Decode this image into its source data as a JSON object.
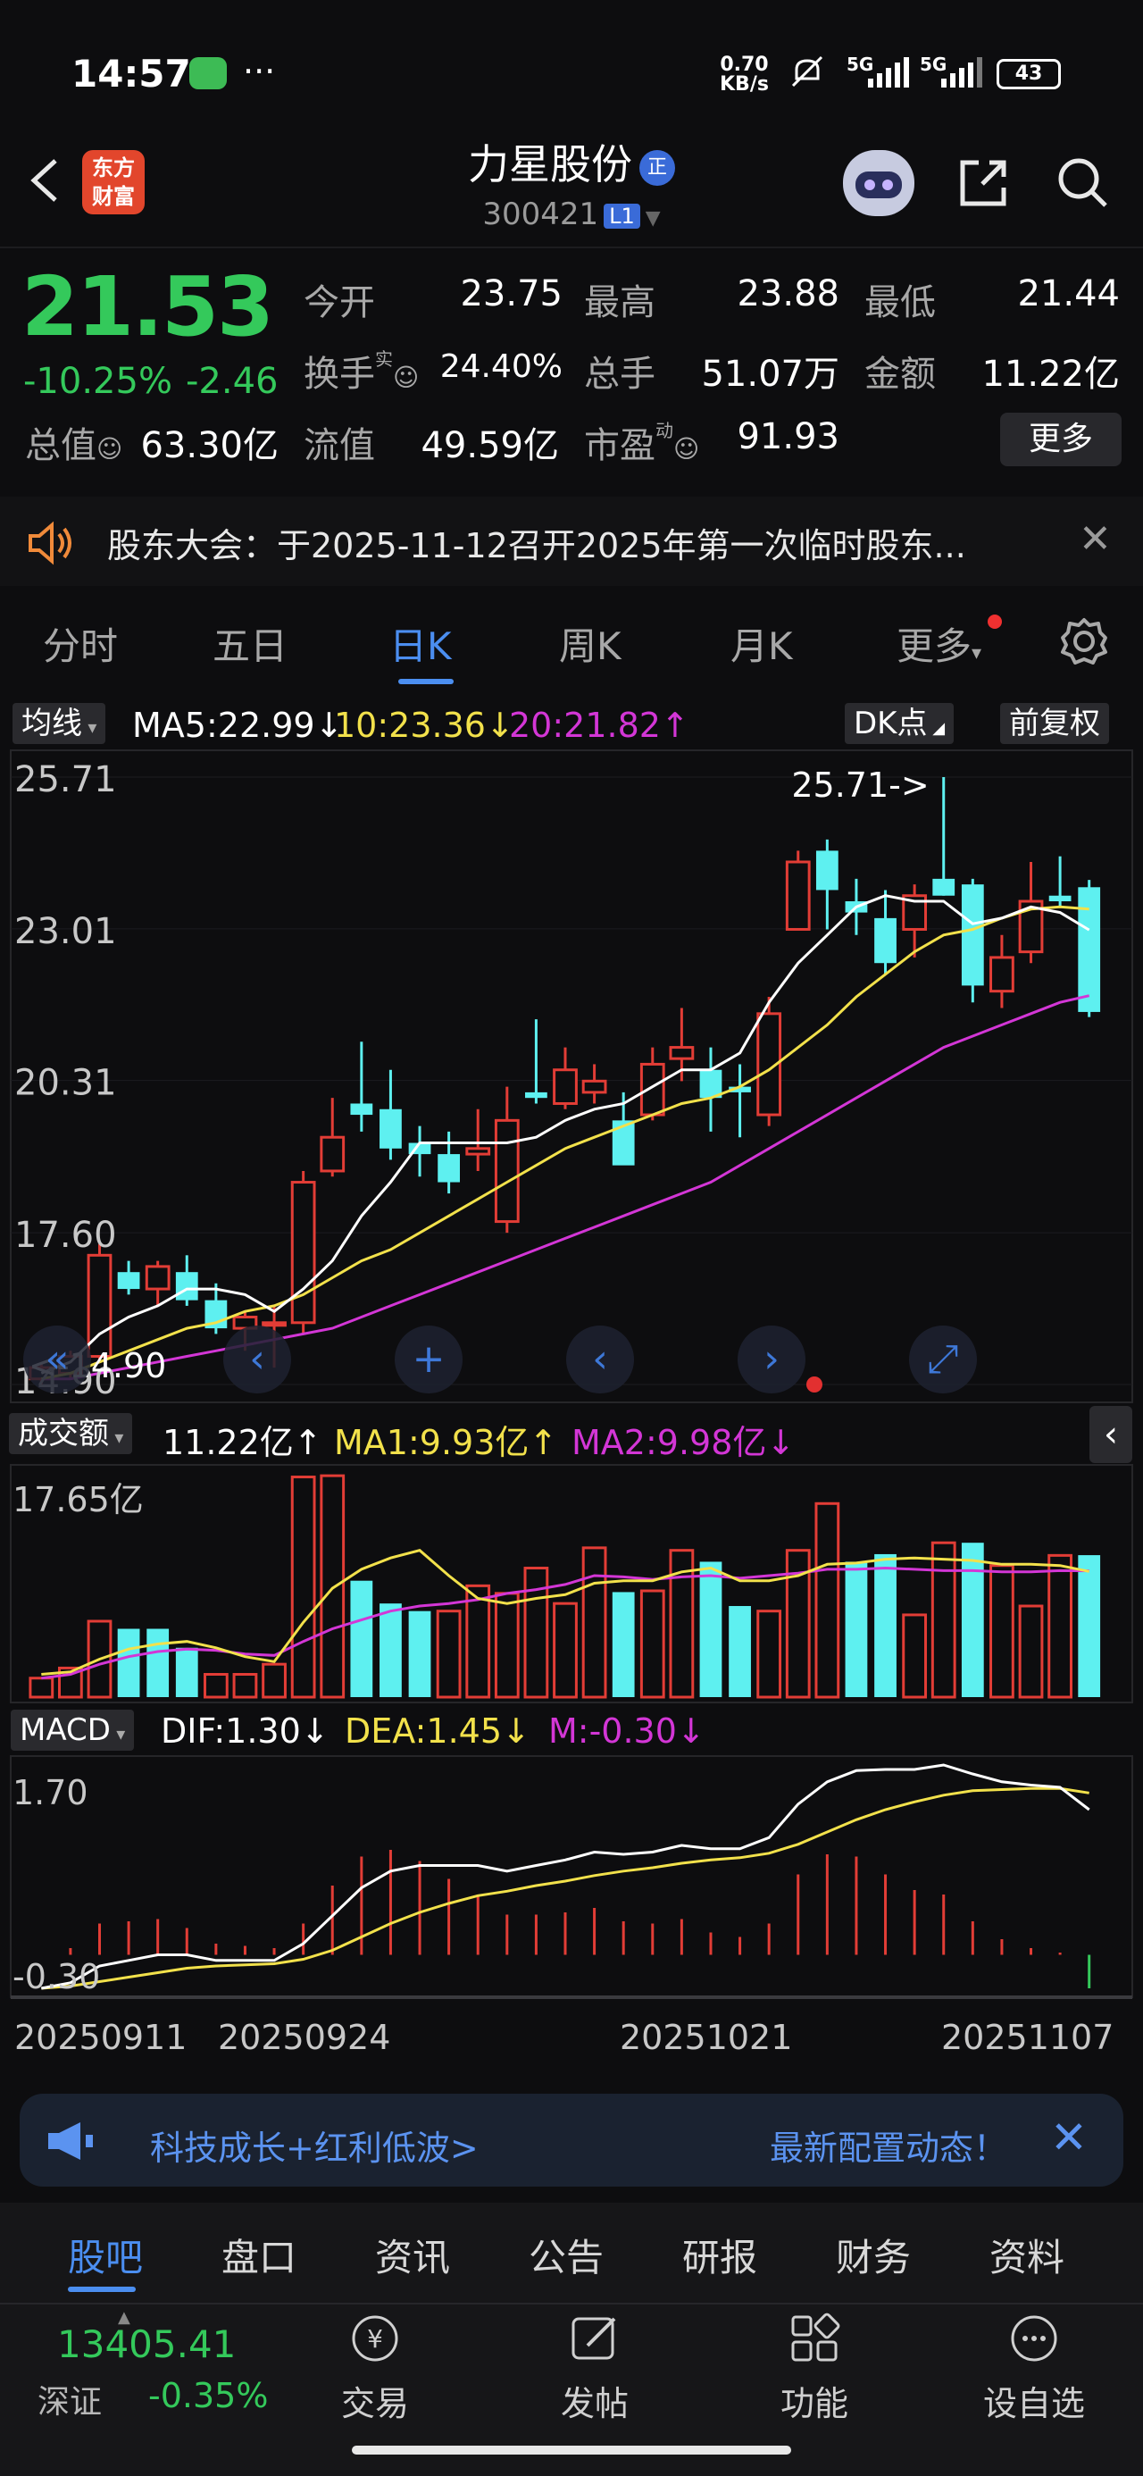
{
  "status_bar": {
    "time": "14:57",
    "dots": "···",
    "net_speed_value": "0.70",
    "net_speed_unit": "KB/s",
    "signal1": "5G",
    "signal2": "5G",
    "battery": "43"
  },
  "header": {
    "logo_line1": "东方",
    "logo_line2": "财富",
    "stock_name": "力星股份",
    "name_badge": "正",
    "stock_code": "300421",
    "level_badge": "L1"
  },
  "quote": {
    "price": "21.53",
    "change_pct": "-10.25%",
    "change_abs": "-2.46",
    "open_label": "今开",
    "open_value": "23.75",
    "high_label": "最高",
    "high_value": "23.88",
    "low_label": "最低",
    "low_value": "21.44",
    "turnover_label": "换手",
    "turnover_sup": "实",
    "turnover_value": "24.40%",
    "volume_label": "总手",
    "volume_value": "51.07万",
    "amount_label": "金额",
    "amount_value": "11.22亿",
    "mktcap_label": "总值",
    "mktcap_value": "63.30亿",
    "float_label": "流值",
    "float_value": "49.59亿",
    "pe_label": "市盈",
    "pe_sup": "动",
    "pe_value": "91.93",
    "more_label": "更多"
  },
  "notice": {
    "text": "股东大会：于2025-11-12召开2025年第一次临时股东..."
  },
  "period_tabs": [
    "分时",
    "五日",
    "日K",
    "周K",
    "月K",
    "更多"
  ],
  "kline_panel": {
    "ma_selector": "均线",
    "ma5_label": "MA5:22.99",
    "ma10_label": "10:23.36",
    "ma20_label": "20:21.82",
    "dk_button": "DK点",
    "adjust_button": "前复权",
    "y_ticks": [
      "25.71",
      "23.01",
      "20.31",
      "17.60",
      "14.90"
    ],
    "max_marker": "25.71->",
    "min_marker": "<-14.90"
  },
  "volume_panel": {
    "selector": "成交额",
    "value": "11.22亿",
    "ma1_label": "MA1:9.93亿",
    "ma2_label": "MA2:9.98亿",
    "y_max": "17.65亿"
  },
  "macd_panel": {
    "selector": "MACD",
    "dif_label": "DIF:1.30",
    "dea_label": "DEA:1.45",
    "m_label": "M:-0.30",
    "y_max": "1.70",
    "y_min": "-0.30"
  },
  "x_dates": [
    "20250911",
    "20250924",
    "20251021",
    "20251107"
  ],
  "banner": {
    "text": "科技成长+红利低波>",
    "right_text": "最新配置动态！"
  },
  "bottom_tabs": [
    "股吧",
    "盘口",
    "资讯",
    "公告",
    "研报",
    "财务",
    "资料"
  ],
  "bottom_nav": {
    "index_value": "13405.41",
    "index_name": "深证",
    "index_pct": "-0.35%",
    "items": [
      "交易",
      "发帖",
      "功能",
      "设自选"
    ]
  },
  "colors": {
    "up": "#e23d36",
    "down": "#5ef0f0",
    "ma5": "#ffffff",
    "ma10": "#f2e14b",
    "ma20": "#d336d6",
    "accent": "#4b8ef0",
    "price_down": "#34c95b"
  },
  "chart_data": {
    "type": "candlestick",
    "x_start": "20250911",
    "x_end": "20251110",
    "ylim": [
      14.9,
      25.71
    ],
    "candles": [
      {
        "o": 15.0,
        "h": 15.3,
        "l": 14.9,
        "c": 15.2
      },
      {
        "o": 15.1,
        "h": 15.5,
        "l": 15.0,
        "c": 15.4
      },
      {
        "o": 15.4,
        "h": 17.4,
        "l": 15.3,
        "c": 17.2
      },
      {
        "o": 16.9,
        "h": 17.1,
        "l": 16.5,
        "c": 16.6
      },
      {
        "o": 16.6,
        "h": 17.1,
        "l": 16.3,
        "c": 17.0
      },
      {
        "o": 16.9,
        "h": 17.2,
        "l": 16.3,
        "c": 16.4
      },
      {
        "o": 16.4,
        "h": 16.7,
        "l": 15.8,
        "c": 15.9
      },
      {
        "o": 15.9,
        "h": 16.2,
        "l": 15.5,
        "c": 16.1
      },
      {
        "o": 16.0,
        "h": 16.3,
        "l": 15.2,
        "c": 16.0
      },
      {
        "o": 16.0,
        "h": 18.7,
        "l": 15.8,
        "c": 18.5
      },
      {
        "o": 18.7,
        "h": 20.0,
        "l": 18.6,
        "c": 19.3
      },
      {
        "o": 19.9,
        "h": 21.0,
        "l": 19.4,
        "c": 19.7
      },
      {
        "o": 19.8,
        "h": 20.5,
        "l": 18.9,
        "c": 19.1
      },
      {
        "o": 19.2,
        "h": 19.5,
        "l": 18.6,
        "c": 19.0
      },
      {
        "o": 19.0,
        "h": 19.4,
        "l": 18.3,
        "c": 18.5
      },
      {
        "o": 19.0,
        "h": 19.8,
        "l": 18.7,
        "c": 19.1
      },
      {
        "o": 17.8,
        "h": 20.2,
        "l": 17.6,
        "c": 19.6
      },
      {
        "o": 20.1,
        "h": 21.4,
        "l": 19.9,
        "c": 20.0
      },
      {
        "o": 19.9,
        "h": 20.9,
        "l": 19.8,
        "c": 20.5
      },
      {
        "o": 20.1,
        "h": 20.6,
        "l": 19.9,
        "c": 20.3
      },
      {
        "o": 19.6,
        "h": 20.1,
        "l": 19.1,
        "c": 18.8
      },
      {
        "o": 19.7,
        "h": 20.9,
        "l": 19.6,
        "c": 20.6
      },
      {
        "o": 20.7,
        "h": 21.6,
        "l": 20.3,
        "c": 20.9
      },
      {
        "o": 20.5,
        "h": 20.9,
        "l": 19.4,
        "c": 20.0
      },
      {
        "o": 20.2,
        "h": 20.6,
        "l": 19.3,
        "c": 20.1
      },
      {
        "o": 19.7,
        "h": 21.8,
        "l": 19.5,
        "c": 21.5
      },
      {
        "o": 23.0,
        "h": 24.4,
        "l": 23.0,
        "c": 24.2
      },
      {
        "o": 24.4,
        "h": 24.6,
        "l": 23.0,
        "c": 23.7
      },
      {
        "o": 23.5,
        "h": 23.9,
        "l": 22.9,
        "c": 23.3
      },
      {
        "o": 23.2,
        "h": 23.7,
        "l": 22.2,
        "c": 22.4
      },
      {
        "o": 23.0,
        "h": 23.8,
        "l": 22.5,
        "c": 23.6
      },
      {
        "o": 23.9,
        "h": 25.71,
        "l": 23.6,
        "c": 23.6
      },
      {
        "o": 23.8,
        "h": 23.9,
        "l": 21.7,
        "c": 22.0
      },
      {
        "o": 21.9,
        "h": 22.9,
        "l": 21.6,
        "c": 22.5
      },
      {
        "o": 22.6,
        "h": 24.2,
        "l": 22.4,
        "c": 23.5
      },
      {
        "o": 23.6,
        "h": 24.3,
        "l": 23.4,
        "c": 23.5
      },
      {
        "o": 23.75,
        "h": 23.88,
        "l": 21.44,
        "c": 21.53
      }
    ],
    "ma5": [
      15.1,
      15.3,
      15.8,
      16.1,
      16.3,
      16.6,
      16.6,
      16.5,
      16.2,
      16.6,
      17.1,
      17.9,
      18.5,
      19.2,
      19.2,
      19.2,
      19.2,
      19.3,
      19.6,
      19.8,
      19.9,
      20.2,
      20.5,
      20.5,
      20.8,
      21.7,
      22.4,
      22.9,
      23.4,
      23.6,
      23.5,
      23.5,
      23.1,
      23.2,
      23.4,
      23.3,
      22.99
    ],
    "ma10": [
      15.0,
      15.1,
      15.3,
      15.5,
      15.7,
      15.9,
      16.0,
      16.2,
      16.3,
      16.5,
      16.8,
      17.1,
      17.3,
      17.6,
      17.9,
      18.2,
      18.5,
      18.8,
      19.1,
      19.3,
      19.5,
      19.7,
      19.9,
      20.0,
      20.2,
      20.5,
      20.9,
      21.3,
      21.8,
      22.2,
      22.6,
      22.9,
      23.0,
      23.2,
      23.36,
      23.4,
      23.36
    ],
    "ma20": [
      15.0,
      15.0,
      15.1,
      15.2,
      15.3,
      15.4,
      15.5,
      15.6,
      15.7,
      15.8,
      15.9,
      16.1,
      16.3,
      16.5,
      16.7,
      16.9,
      17.1,
      17.3,
      17.5,
      17.7,
      17.9,
      18.1,
      18.3,
      18.5,
      18.8,
      19.1,
      19.4,
      19.7,
      20.0,
      20.3,
      20.6,
      20.9,
      21.1,
      21.3,
      21.5,
      21.7,
      21.82
    ],
    "volume_yi": [
      1.5,
      2.3,
      6.0,
      5.4,
      5.4,
      3.9,
      1.8,
      1.8,
      2.6,
      17.4,
      17.5,
      9.2,
      7.4,
      6.8,
      6.8,
      8.8,
      8.2,
      10.2,
      7.4,
      11.8,
      8.3,
      8.4,
      11.6,
      10.7,
      7.2,
      6.8,
      11.6,
      15.3,
      10.7,
      11.3,
      6.5,
      12.2,
      12.2,
      10.4,
      7.2,
      11.2,
      11.22
    ],
    "volume_up": [
      true,
      true,
      true,
      false,
      false,
      false,
      true,
      true,
      true,
      true,
      true,
      false,
      false,
      false,
      true,
      true,
      true,
      true,
      true,
      true,
      false,
      true,
      true,
      false,
      false,
      true,
      true,
      true,
      false,
      false,
      true,
      true,
      false,
      true,
      true,
      true,
      false
    ],
    "volume_ma1": [
      1.8,
      2.0,
      3.0,
      3.8,
      4.2,
      4.4,
      3.9,
      3.2,
      2.8,
      5.9,
      8.6,
      10.1,
      11.0,
      11.6,
      9.6,
      7.8,
      7.4,
      7.8,
      8.1,
      9.0,
      9.2,
      9.2,
      9.9,
      10.2,
      9.2,
      9.2,
      9.6,
      10.5,
      10.6,
      10.9,
      11.0,
      10.9,
      10.8,
      10.5,
      10.5,
      10.4,
      9.93
    ],
    "volume_ma2": [
      1.5,
      1.8,
      2.6,
      3.2,
      3.6,
      3.8,
      3.7,
      3.4,
      3.3,
      4.4,
      5.4,
      6.1,
      6.8,
      7.2,
      7.4,
      7.7,
      8.2,
      8.5,
      8.9,
      9.6,
      9.5,
      9.3,
      9.5,
      9.6,
      9.4,
      9.6,
      9.8,
      10.1,
      10.1,
      10.2,
      10.1,
      10.0,
      10.0,
      9.9,
      9.9,
      10.0,
      9.98
    ],
    "macd_dif": [
      -0.3,
      -0.25,
      -0.1,
      -0.05,
      0.0,
      0.0,
      -0.05,
      -0.05,
      -0.05,
      0.1,
      0.35,
      0.6,
      0.75,
      0.8,
      0.8,
      0.8,
      0.75,
      0.8,
      0.85,
      0.92,
      0.9,
      0.92,
      0.98,
      0.95,
      0.95,
      1.05,
      1.35,
      1.55,
      1.65,
      1.66,
      1.66,
      1.7,
      1.62,
      1.55,
      1.52,
      1.5,
      1.3
    ],
    "macd_dea": [
      -0.3,
      -0.28,
      -0.24,
      -0.2,
      -0.16,
      -0.12,
      -0.1,
      -0.09,
      -0.08,
      -0.04,
      0.04,
      0.16,
      0.28,
      0.38,
      0.46,
      0.53,
      0.57,
      0.62,
      0.66,
      0.71,
      0.75,
      0.78,
      0.82,
      0.85,
      0.87,
      0.91,
      0.99,
      1.1,
      1.21,
      1.3,
      1.37,
      1.43,
      1.47,
      1.48,
      1.49,
      1.49,
      1.45
    ],
    "macd_m": [
      0.0,
      0.06,
      0.28,
      0.3,
      0.32,
      0.24,
      0.1,
      0.08,
      0.06,
      0.28,
      0.62,
      0.88,
      0.94,
      0.84,
      0.68,
      0.54,
      0.36,
      0.36,
      0.38,
      0.42,
      0.3,
      0.28,
      0.32,
      0.2,
      0.16,
      0.28,
      0.72,
      0.9,
      0.88,
      0.72,
      0.58,
      0.54,
      0.3,
      0.14,
      0.06,
      0.02,
      -0.3
    ]
  }
}
